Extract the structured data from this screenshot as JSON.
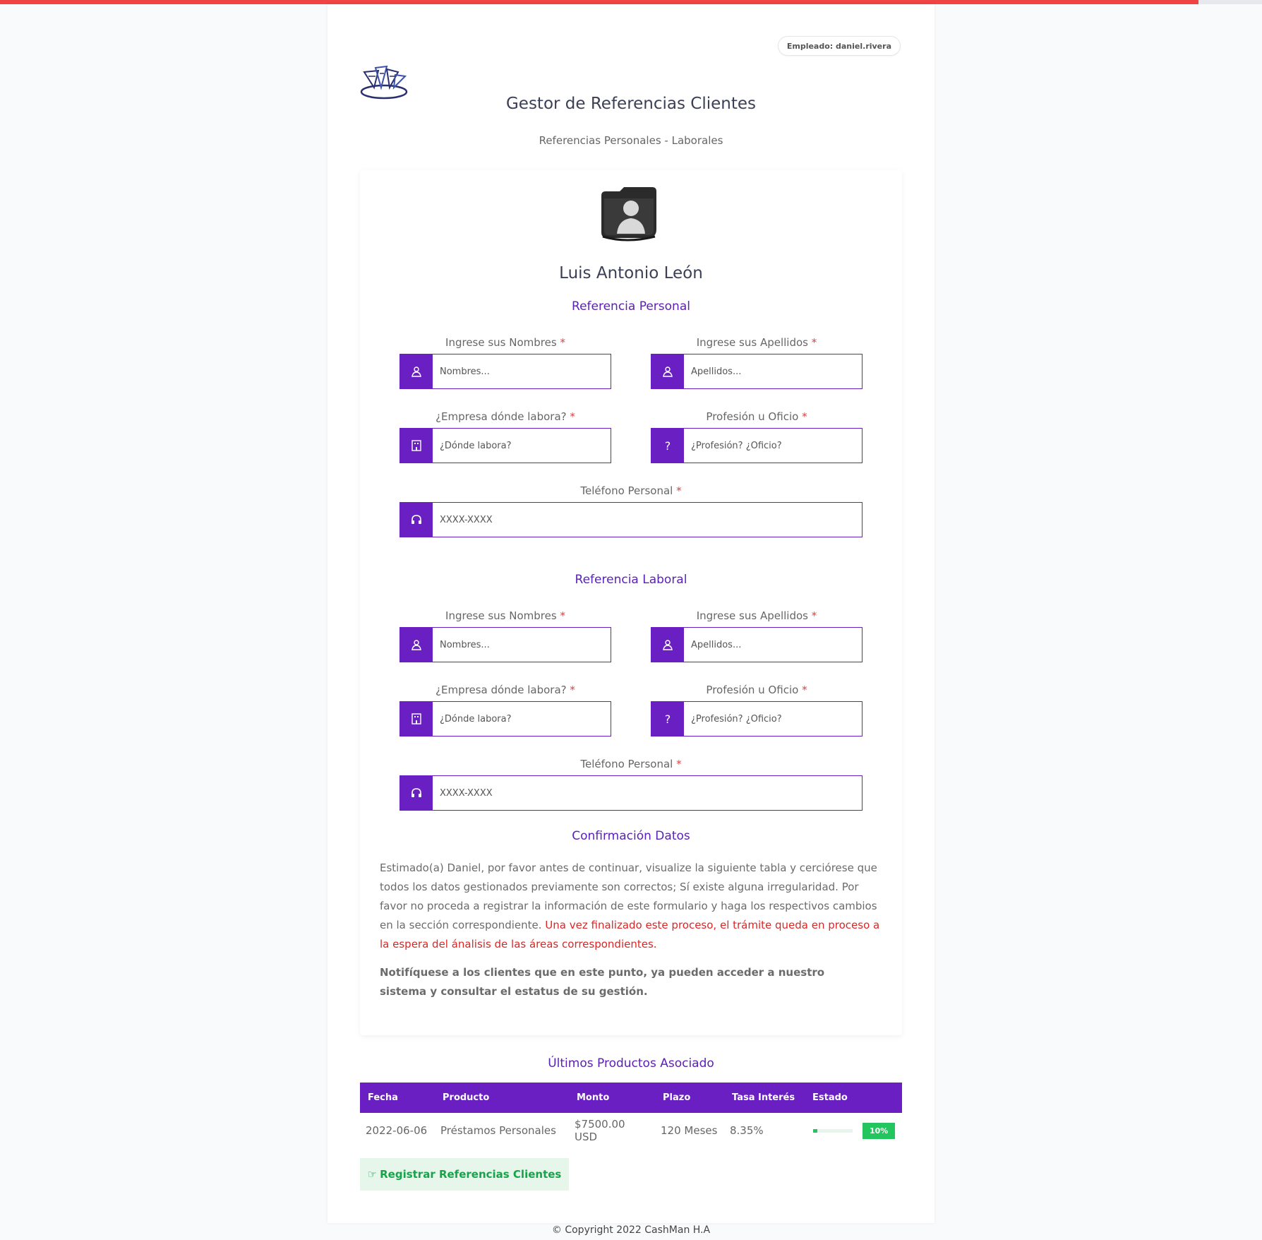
{
  "header": {
    "employee_label": "Empleado: daniel.rivera",
    "title": "Gestor de Referencias Clientes",
    "subtitle": "Referencias Personales - Laborales"
  },
  "client": {
    "name": "Luis Antonio León"
  },
  "personal_ref": {
    "section_title": "Referencia Personal",
    "nombres_label": "Ingrese sus Nombres",
    "nombres_placeholder": "Nombres...",
    "apellidos_label": "Ingrese sus Apellidos",
    "apellidos_placeholder": "Apellidos...",
    "empresa_label": "¿Empresa dónde labora?",
    "empresa_placeholder": "¿Dónde labora?",
    "profesion_label": "Profesión u Oficio",
    "profesion_placeholder": "¿Profesión? ¿Oficio?",
    "telefono_label": "Teléfono Personal",
    "telefono_placeholder": "XXXX-XXXX"
  },
  "work_ref": {
    "section_title": "Referencia Laboral",
    "nombres_label": "Ingrese sus Nombres",
    "nombres_placeholder": "Nombres...",
    "apellidos_label": "Ingrese sus Apellidos",
    "apellidos_placeholder": "Apellidos...",
    "empresa_label": "¿Empresa dónde labora?",
    "empresa_placeholder": "¿Dónde labora?",
    "profesion_label": "Profesión u Oficio",
    "profesion_placeholder": "¿Profesión? ¿Oficio?",
    "telefono_label": "Teléfono Personal",
    "telefono_placeholder": "XXXX-XXXX"
  },
  "required_mark": "*",
  "confirm": {
    "section_title": "Confirmación Datos",
    "text": "Estimado(a) Daniel, por favor antes de continuar, visualize la siguiente tabla y cerciórese que todos los datos gestionados previamente son correctos; Sí existe alguna irregularidad. Por favor no proceda a registrar la información de este formulario y haga los respectivos cambios en la sección correspondiente.",
    "warning": "Una vez finalizado este proceso, el trámite queda en proceso a la espera del ánalisis de las áreas correspondientes.",
    "notify": "Notifíquese a los clientes que en este punto, ya pueden acceder a nuestro sistema y consultar el estatus de su gestión."
  },
  "products": {
    "title": "Últimos Productos Asociado",
    "columns": [
      "Fecha",
      "Producto",
      "Monto",
      "Plazo",
      "Tasa Interés",
      "Estado"
    ],
    "rows": [
      {
        "fecha": "2022-06-06",
        "producto": "Préstamos Personales",
        "monto": "$7500.00 USD",
        "plazo": "120 Meses",
        "tasa": "8.35%",
        "estado_pct": 10,
        "estado_label": "10%"
      }
    ]
  },
  "register_button": {
    "icon": "☞",
    "label": "Registrar Referencias Clientes"
  },
  "footer": {
    "copyright": "© Copyright 2022 CashMan H.A"
  },
  "colors": {
    "accent": "#6a1fc2",
    "section": "#5b21b6",
    "success": "#22c55e",
    "danger": "#dc2626",
    "topbar": "#f04343"
  },
  "icons": {
    "nombres": "user-icon",
    "apellidos": "user-icon",
    "empresa": "building-icon",
    "profesion": "question-icon",
    "telefono": "headset-icon"
  }
}
